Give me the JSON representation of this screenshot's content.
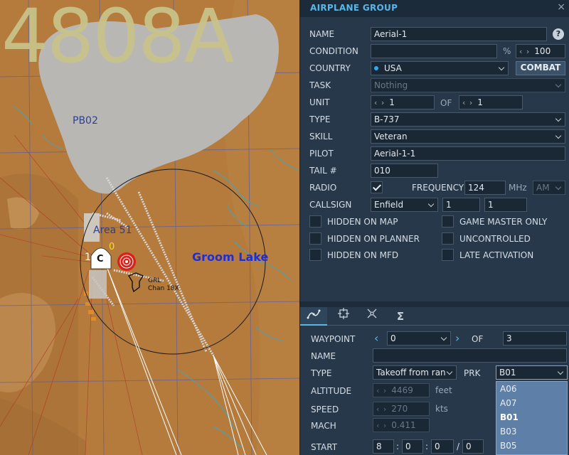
{
  "map": {
    "grid_title": "4808A",
    "labels": {
      "pb02": "PB02",
      "area51": "Area 51",
      "groom_lake": "Groom Lake",
      "unit_one": "1",
      "unit_zero": "0",
      "airfield_marker": "C",
      "beacon_line1": "GRL",
      "beacon_line2": "Chan 18X"
    }
  },
  "panel": {
    "title": "AIRPLANE GROUP",
    "close": "×",
    "name": {
      "label": "NAME",
      "value": "Aerial-1",
      "help": "?"
    },
    "condition": {
      "label": "CONDITION",
      "value": "",
      "unit": "%",
      "spin": "100"
    },
    "country": {
      "label": "COUNTRY",
      "value": "USA",
      "combat_button": "COMBAT"
    },
    "task": {
      "label": "TASK",
      "value": "Nothing"
    },
    "unit": {
      "label": "UNIT",
      "value": "1",
      "of_label": "OF",
      "of_value": "1"
    },
    "type": {
      "label": "TYPE",
      "value": "B-737"
    },
    "skill": {
      "label": "SKILL",
      "value": "Veteran"
    },
    "pilot": {
      "label": "PILOT",
      "value": "Aerial-1-1"
    },
    "tail": {
      "label": "TAIL #",
      "value": "010"
    },
    "radio": {
      "label": "RADIO",
      "checked": true,
      "frequency_label": "FREQUENCY",
      "frequency_value": "124",
      "frequency_unit": "MHz",
      "modulation": "AM"
    },
    "callsign": {
      "label": "CALLSIGN",
      "value": "Enfield",
      "num1": "1",
      "num2": "1"
    },
    "checkboxes": {
      "hidden_on_map": "HIDDEN ON MAP",
      "game_master_only": "GAME MASTER ONLY",
      "hidden_on_planner": "HIDDEN ON PLANNER",
      "uncontrolled": "UNCONTROLLED",
      "hidden_on_mfd": "HIDDEN ON MFD",
      "late_activation": "LATE ACTIVATION"
    },
    "tabs": [
      "route-icon",
      "target-icon",
      "payload-icon",
      "summary-icon"
    ],
    "waypoint": {
      "label": "WAYPOINT",
      "value": "0",
      "of_label": "OF",
      "of_value": "3",
      "name_label": "NAME",
      "name_value": "",
      "type_label": "TYPE",
      "type_value": "Takeoff from ran",
      "prk_label": "PRK",
      "prk_value": "B01",
      "prk_options": [
        "A06",
        "A07",
        "B01",
        "B03",
        "B05"
      ],
      "prk_selected_index": 2,
      "altitude_label": "ALTITUDE",
      "altitude_value": "4469",
      "altitude_unit": "feet",
      "speed_label": "SPEED",
      "speed_value": "270",
      "speed_unit": "kts",
      "mach_label": "MACH",
      "mach_value": "0.411",
      "start_label": "START",
      "start_day": "8",
      "start_h": "0",
      "start_m": "0",
      "start_s": "0",
      "sep_colon": ":",
      "sep_slash": "/"
    }
  }
}
